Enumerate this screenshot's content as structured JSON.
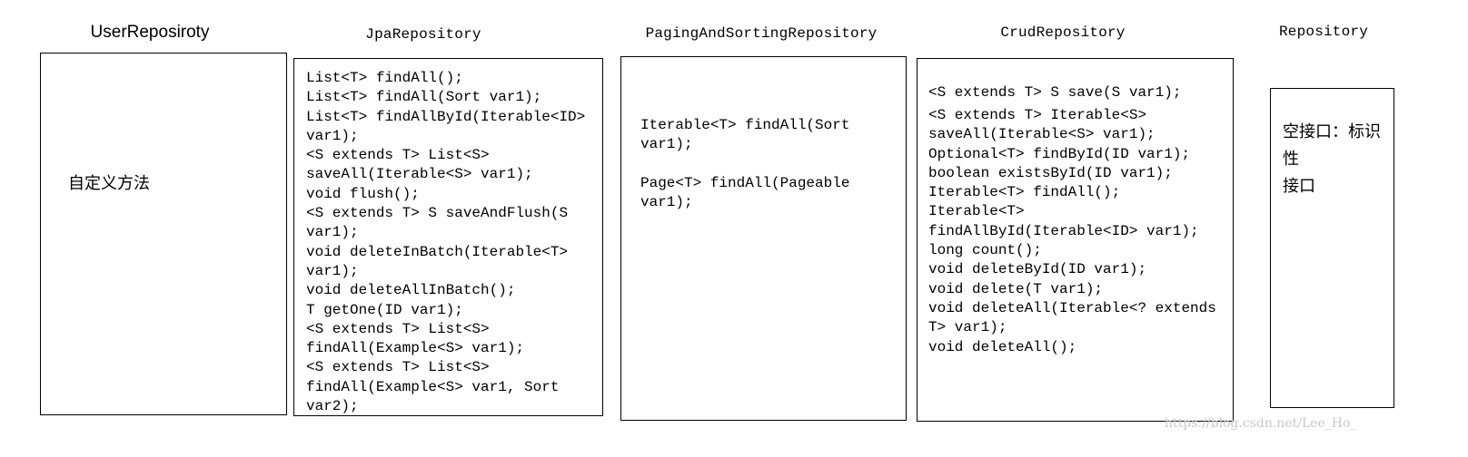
{
  "columns": [
    {
      "title": "UserReposiroty",
      "content_lines": [
        "自定义方法"
      ]
    },
    {
      "title": "JpaRepository",
      "content_lines": [
        "List<T> findAll();",
        "List<T> findAll(Sort var1);",
        "List<T> findAllById(Iterable<ID>",
        "var1);",
        "<S extends T> List<S>",
        "saveAll(Iterable<S> var1);",
        "void flush();",
        "<S extends T> S saveAndFlush(S",
        "var1);",
        "void deleteInBatch(Iterable<T>",
        "var1);",
        "void deleteAllInBatch();",
        "T getOne(ID var1);",
        "<S extends T> List<S>",
        "findAll(Example<S> var1);",
        "<S extends T> List<S>",
        "findAll(Example<S> var1, Sort",
        "var2);"
      ]
    },
    {
      "title": "PagingAndSortingRepository",
      "content_lines": [
        "Iterable<T> findAll(Sort",
        "var1);",
        "",
        "Page<T> findAll(Pageable",
        "var1);"
      ]
    },
    {
      "title": "CrudRepository",
      "content_lines": [
        "<S extends T> S save(S var1);",
        "<S extends T> Iterable<S>",
        "saveAll(Iterable<S> var1);",
        "Optional<T> findById(ID var1);",
        "boolean existsById(ID var1);",
        "Iterable<T> findAll();",
        "Iterable<T>",
        "findAllById(Iterable<ID> var1);",
        "long count();",
        "void deleteById(ID var1);",
        "void delete(T var1);",
        "void deleteAll(Iterable<? extends",
        "T> var1);",
        "void deleteAll();"
      ]
    },
    {
      "title": "Repository",
      "content_lines": [
        "空接口：标识性",
        "接口"
      ]
    }
  ],
  "watermark": "https://blog.csdn.net/Lee_Ho_"
}
